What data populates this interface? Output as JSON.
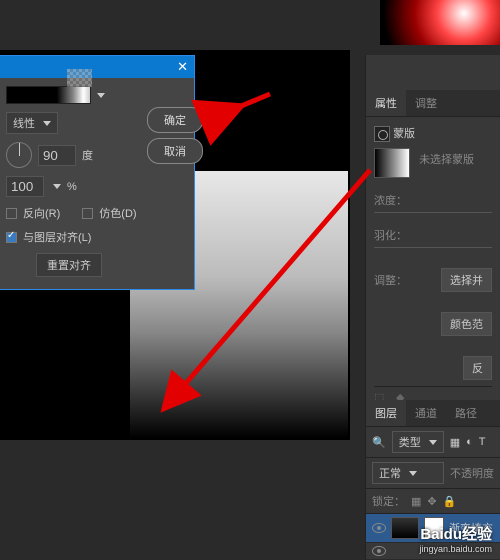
{
  "dialog": {
    "close": "✕",
    "style_label": "线性",
    "angle_value": "90",
    "angle_unit": "度",
    "scale_value": "100",
    "scale_unit": "%",
    "reverse": "反向(R)",
    "dither": "仿色(D)",
    "align": "与图层对齐(L)",
    "reset_align": "重置对齐",
    "ok": "确定",
    "cancel": "取消"
  },
  "props": {
    "tab_props": "属性",
    "tab_adjust": "调整",
    "mask_label": "蒙版",
    "no_mask": "未选择蒙版",
    "density": "浓度：",
    "feather": "羽化：",
    "adjust": "调整：",
    "btn_select": "选择并",
    "btn_color": "颜色范",
    "btn_invert": "反"
  },
  "layers": {
    "tab_layer": "图层",
    "tab_channel": "通道",
    "tab_path": "路径",
    "kind": "类型",
    "blend": "正常",
    "opacity": "不透明度",
    "lock": "锁定：",
    "fill_layer": "渐变填充"
  },
  "watermark": {
    "logo": "Baidu经验",
    "url": "jingyan.baidu.com"
  }
}
